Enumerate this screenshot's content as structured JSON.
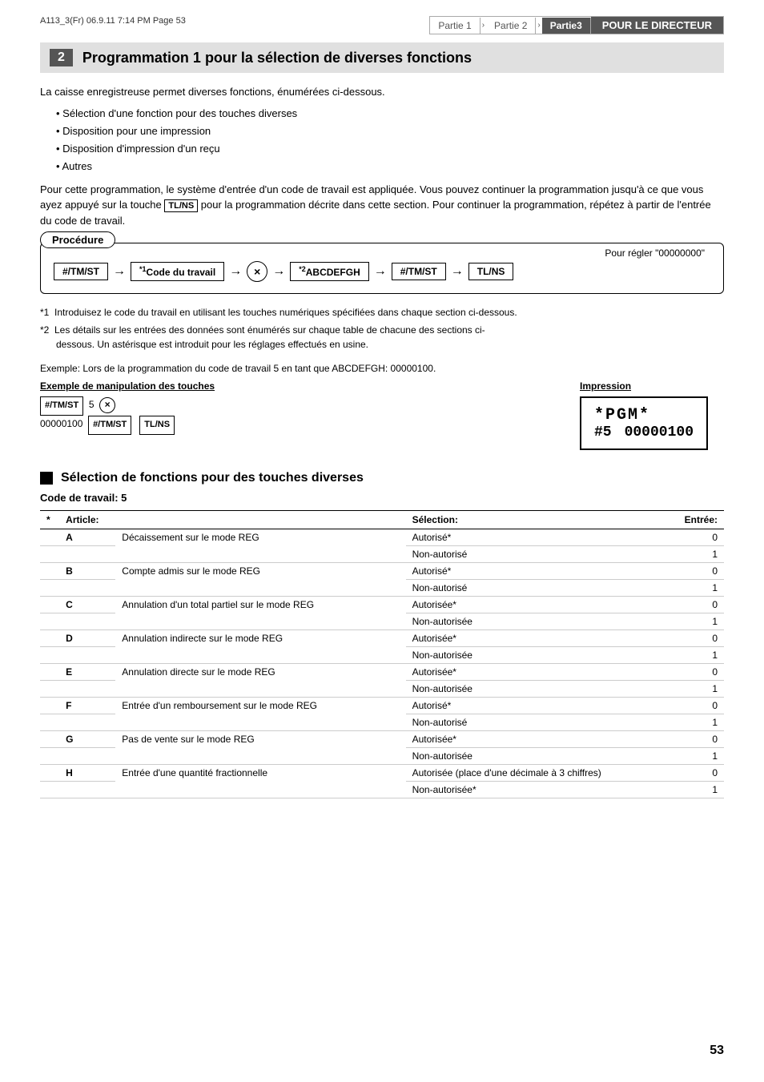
{
  "header": {
    "left_text": "A113_3(Fr)   06.9.11  7:14 PM   Page 53",
    "breadcrumb": [
      {
        "label": "Partie 1",
        "active": false
      },
      {
        "label": "Partie 2",
        "active": false
      },
      {
        "label": "Partie3",
        "active": true
      },
      {
        "label": "POUR LE DIRECTEUR",
        "active": true,
        "is_title": true
      }
    ]
  },
  "section": {
    "number": "2",
    "title": "Programmation 1 pour la sélection de diverses fonctions"
  },
  "intro": {
    "paragraph1": "La caisse enregistreuse permet diverses fonctions, énumérées ci-dessous.",
    "bullets": [
      "Sélection d'une fonction pour des touches diverses",
      "Disposition pour une impression",
      "Disposition d'impression d'un reçu",
      "Autres"
    ],
    "paragraph2": "Pour cette programmation, le système d'entrée d'un code de travail est appliquée. Vous pouvez continuer la programmation jusqu'à ce que vous ayez appuyé sur la touche  pour la programmation décrite dans cette section. Pour continuer la programmation, répétez à partir de l'entrée du code de travail."
  },
  "procedure": {
    "label": "Procédure",
    "pour_regler": "Pour régler \"00000000\"",
    "flow": [
      {
        "type": "box",
        "text": "#/TM/ST"
      },
      {
        "type": "arrow"
      },
      {
        "type": "box",
        "text": "*1Code du travail",
        "superscript": "*1"
      },
      {
        "type": "arrow"
      },
      {
        "type": "circle",
        "text": "×"
      },
      {
        "type": "arrow"
      },
      {
        "type": "box",
        "text": "*2ABCDEFGH",
        "superscript": "*2"
      },
      {
        "type": "arrow"
      },
      {
        "type": "box",
        "text": "#/TM/ST"
      },
      {
        "type": "arrow"
      },
      {
        "type": "box",
        "text": "TL/NS"
      }
    ]
  },
  "notes": [
    "*1  Introduisez le code du travail en utilisant les touches numériques spécifiées dans chaque section ci-dessous.",
    "*2  Les détails sur les entrées des données sont énumérés sur chaque table de chacune des sections ci-dessous. Un astérisque est introduit pour les réglages effectués en usine."
  ],
  "example": {
    "label": "Exemple:  Lors de la programmation du code de travail 5 en tant que ABCDEFGH: 00000100.",
    "keys_header": "Exemple de manipulation des touches",
    "print_header": "Impression",
    "key_sequence_line1": "#/TM/ST  5  ×",
    "key_sequence_line2": "00000100  #/TM/ST  TL/NS",
    "print_line1": "*PGM*",
    "print_line2": "#5",
    "print_line3": "00000100"
  },
  "subsection": {
    "title": "Sélection de fonctions pour des touches diverses",
    "work_code_label": "Code de travail: 5"
  },
  "table": {
    "headers": [
      "*",
      "Article:",
      "",
      "Sélection:",
      "Entrée:"
    ],
    "rows": [
      {
        "star": "*",
        "letter": "A",
        "desc": "Décaissement sur le mode REG",
        "rows_inner": [
          {
            "selection": "Autorisé*",
            "entree": "0"
          },
          {
            "selection": "Non-autorisé",
            "entree": "1"
          }
        ]
      },
      {
        "star": "",
        "letter": "B",
        "desc": "Compte admis sur le mode REG",
        "rows_inner": [
          {
            "selection": "Autorisé*",
            "entree": "0"
          },
          {
            "selection": "Non-autorisé",
            "entree": "1"
          }
        ]
      },
      {
        "star": "",
        "letter": "C",
        "desc": "Annulation d'un total partiel sur le mode REG",
        "rows_inner": [
          {
            "selection": "Autorisée*",
            "entree": "0"
          },
          {
            "selection": "Non-autorisée",
            "entree": "1"
          }
        ]
      },
      {
        "star": "",
        "letter": "D",
        "desc": "Annulation indirecte sur le mode REG",
        "rows_inner": [
          {
            "selection": "Autorisée*",
            "entree": "0"
          },
          {
            "selection": "Non-autorisée",
            "entree": "1"
          }
        ]
      },
      {
        "star": "",
        "letter": "E",
        "desc": "Annulation directe sur le mode REG",
        "rows_inner": [
          {
            "selection": "Autorisée*",
            "entree": "0"
          },
          {
            "selection": "Non-autorisée",
            "entree": "1"
          }
        ]
      },
      {
        "star": "",
        "letter": "F",
        "desc": "Entrée d'un remboursement sur le mode REG",
        "rows_inner": [
          {
            "selection": "Autorisé*",
            "entree": "0"
          },
          {
            "selection": "Non-autorisé",
            "entree": "1"
          }
        ]
      },
      {
        "star": "",
        "letter": "G",
        "desc": "Pas de vente sur le mode REG",
        "rows_inner": [
          {
            "selection": "Autorisée*",
            "entree": "0"
          },
          {
            "selection": "Non-autorisée",
            "entree": "1"
          }
        ]
      },
      {
        "star": "",
        "letter": "H",
        "desc": "Entrée d'une quantité fractionnelle",
        "rows_inner": [
          {
            "selection": "Autorisée (place d'une décimale à 3 chiffres)",
            "entree": "0"
          },
          {
            "selection": "Non-autorisée*",
            "entree": "1"
          }
        ]
      }
    ]
  },
  "page_number": "53"
}
